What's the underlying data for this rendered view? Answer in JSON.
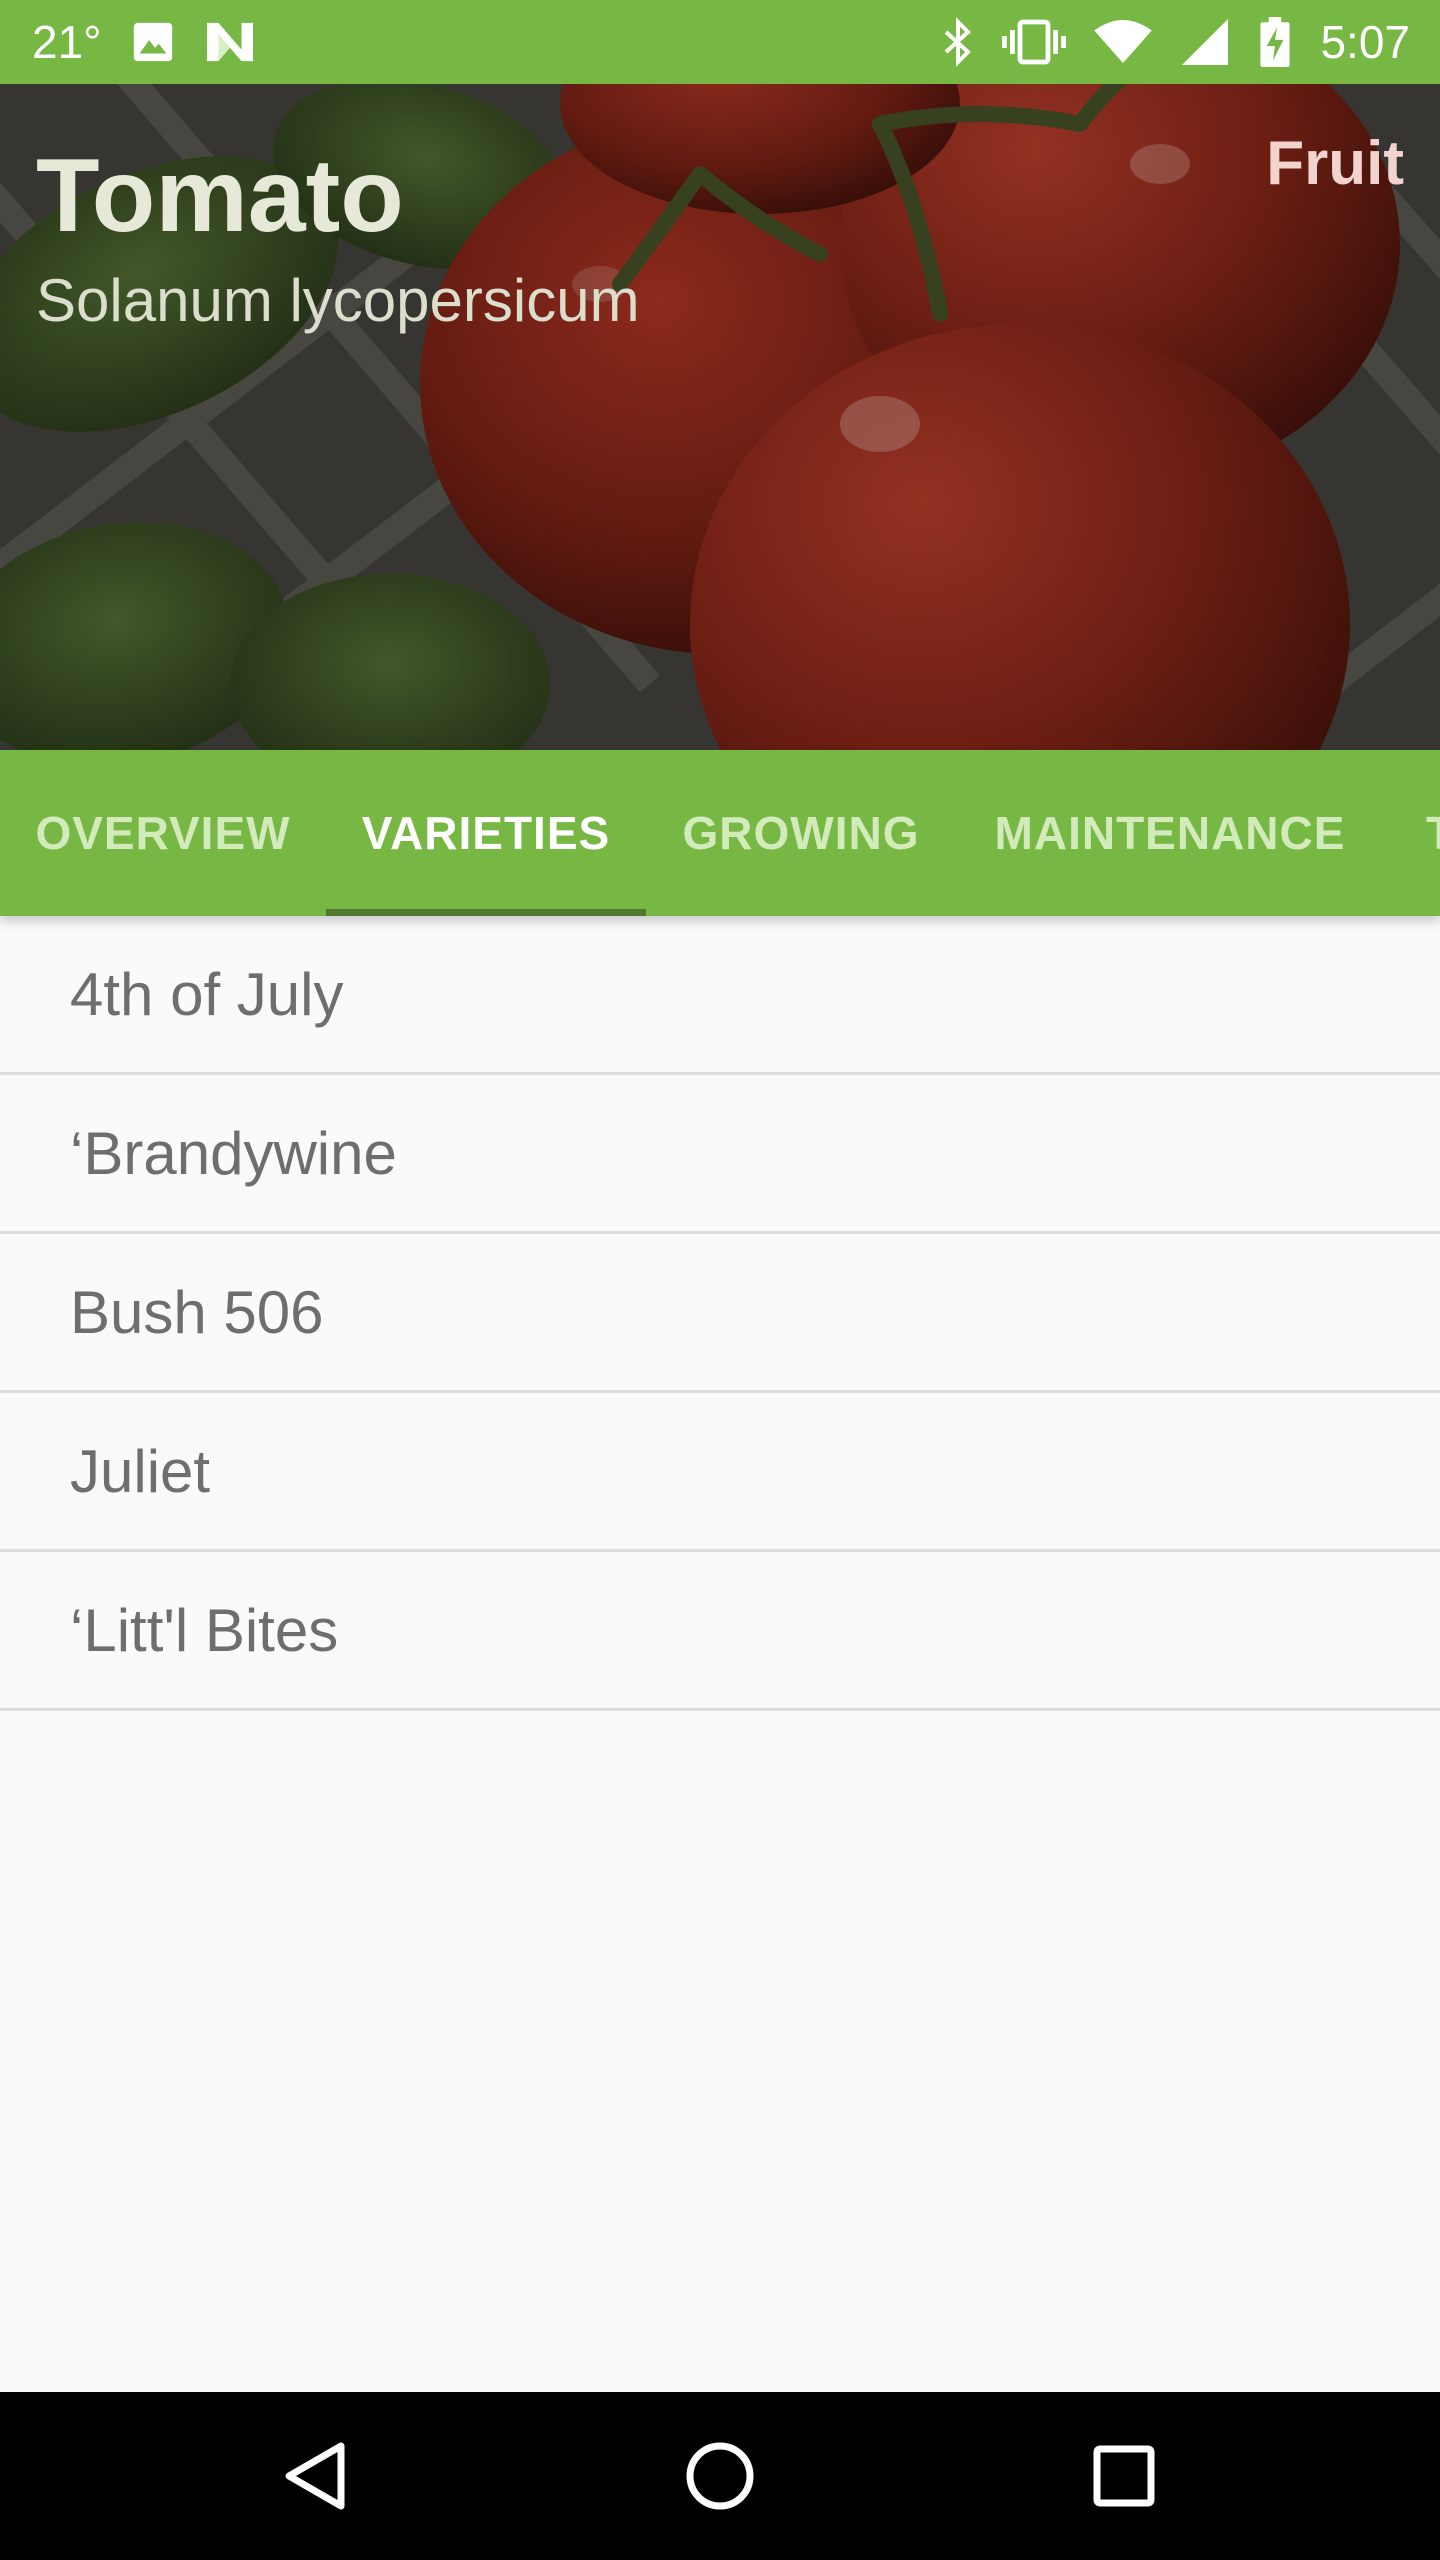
{
  "status_bar": {
    "temperature": "21°",
    "time": "5:07",
    "icons": [
      "image-icon",
      "n-logo-icon",
      "bluetooth-icon",
      "vibrate-icon",
      "wifi-icon",
      "cell-signal-icon",
      "battery-charging-icon"
    ]
  },
  "hero": {
    "title": "Tomato",
    "subtitle": "Solanum lycopersicum",
    "category": "Fruit"
  },
  "tabs": {
    "items": [
      {
        "label": "OVERVIEW",
        "active": false
      },
      {
        "label": "VARIETIES",
        "active": true
      },
      {
        "label": "GROWING",
        "active": false
      },
      {
        "label": "MAINTENANCE",
        "active": false
      },
      {
        "label": "T",
        "active": false
      }
    ]
  },
  "varieties": [
    "4th of July",
    "‘Brandywine",
    "Bush 506",
    "Juliet",
    "‘Litt'l Bites"
  ],
  "nav_bar": {
    "icons": [
      "back-icon",
      "home-icon",
      "recents-icon"
    ]
  },
  "colors": {
    "primary": "#76b843",
    "indicator": "#4f7a2d",
    "background": "#fafafa"
  }
}
